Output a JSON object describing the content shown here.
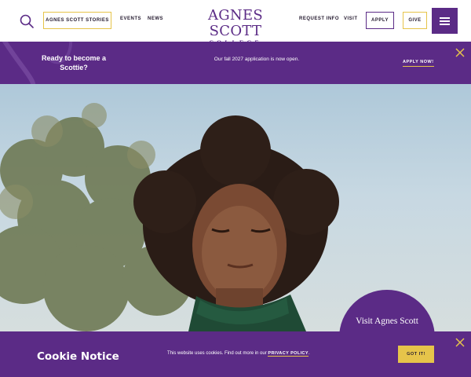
{
  "header": {
    "nav_stories": "AGNES SCOTT STORIES",
    "nav_events": "EVENTS",
    "nav_news": "NEWS",
    "logo_main": "AGNES SCOTT",
    "logo_sub": "COLLEGE",
    "nav_request_info": "REQUEST INFO",
    "nav_visit": "VISIT",
    "apply_label": "APPLY",
    "give_label": "GIVE",
    "search_icon": "search-icon",
    "menu_icon": "hamburger-menu-icon"
  },
  "promo": {
    "title": "Ready to become a Scottie?",
    "text": "Our fall 2027 application is now open.",
    "cta": "APPLY NOW!",
    "close_icon": "close-icon"
  },
  "hero": {
    "visit_label": "Visit Agnes Scott"
  },
  "cookie": {
    "title": "Cookie Notice",
    "text": "This website uses cookies.  Find out more in our",
    "link": "PRIVACY POLICY",
    "period": ".",
    "button": "GOT IT!",
    "close_icon": "close-icon"
  },
  "colors": {
    "brand_purple": "#5b2b86",
    "accent_gold": "#e6c44a",
    "text_dark": "#23192e"
  }
}
